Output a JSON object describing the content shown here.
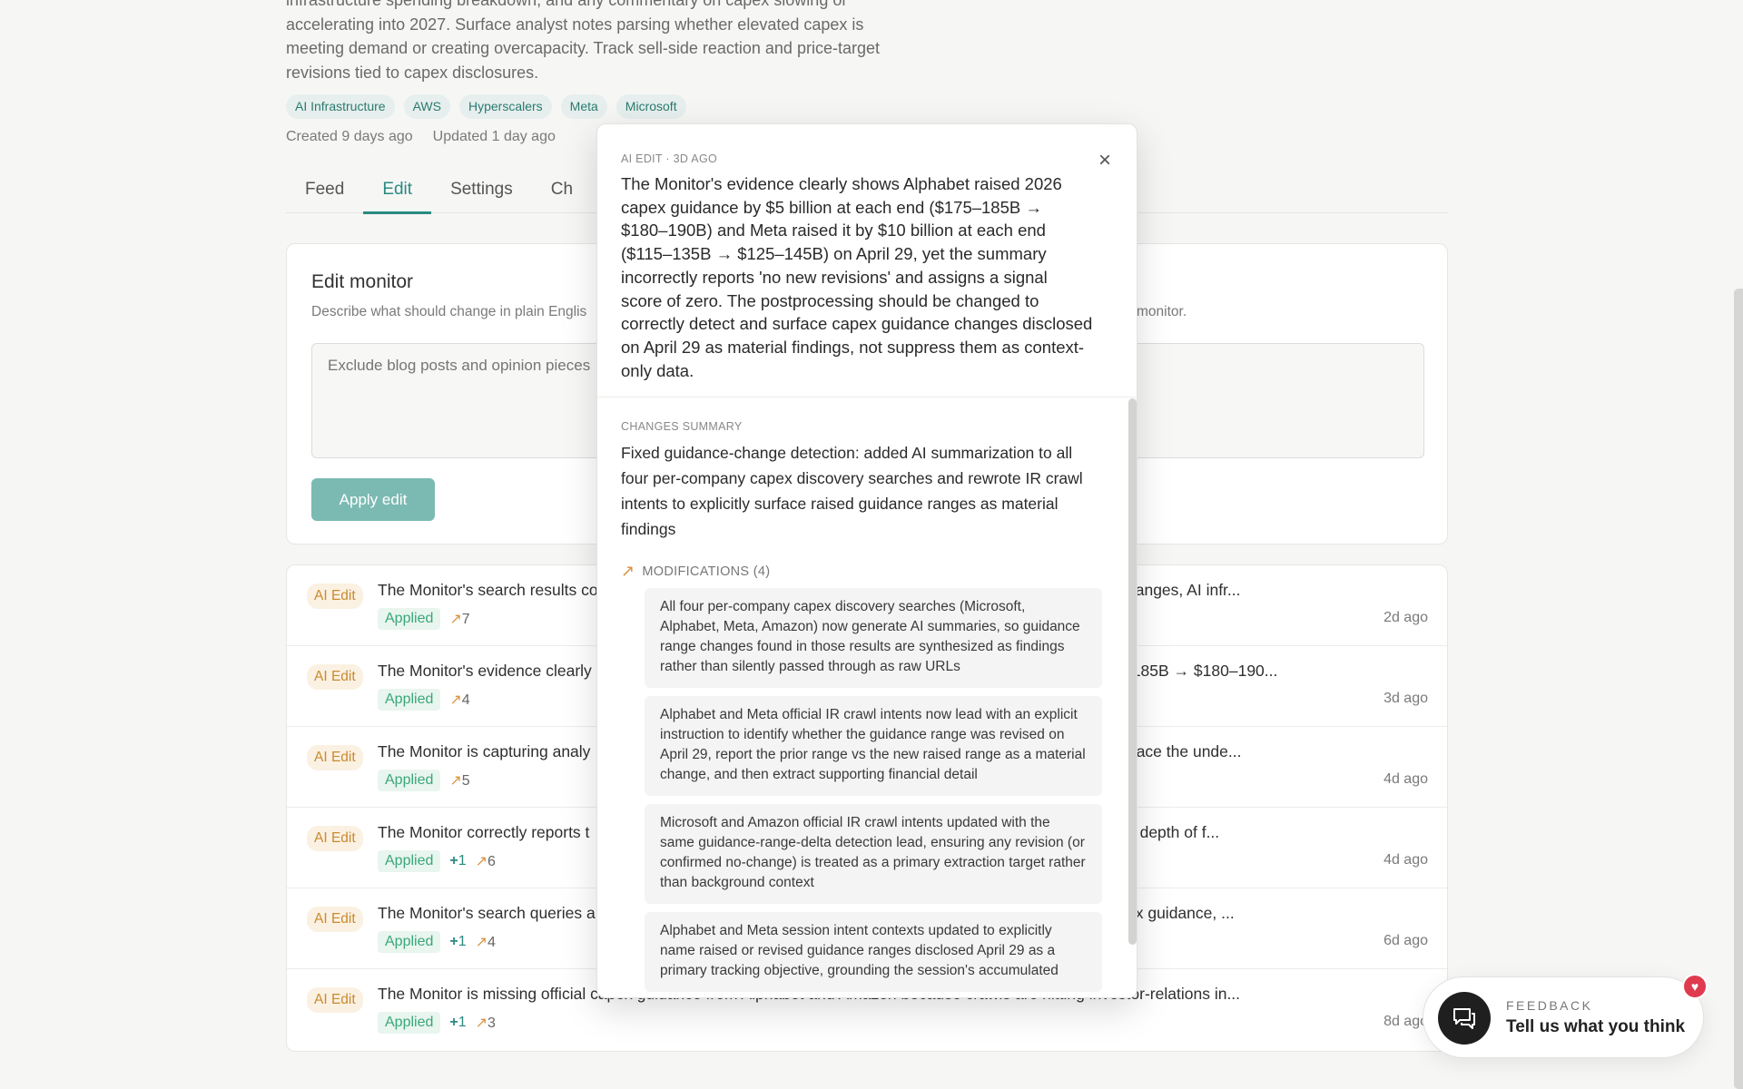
{
  "monitor": {
    "description": "infrastructure spending breakdown, and any commentary on capex slowing or accelerating into 2027. Surface analyst notes parsing whether elevated capex is meeting demand or creating overcapacity. Track sell-side reaction and price-target revisions tied to capex disclosures.",
    "tags": [
      "AI Infrastructure",
      "AWS",
      "Hyperscalers",
      "Meta",
      "Microsoft"
    ],
    "created": "Created 9 days ago",
    "updated": "Updated 1 day ago"
  },
  "tabs": [
    {
      "label": "Feed",
      "active": false
    },
    {
      "label": "Edit",
      "active": true
    },
    {
      "label": "Settings",
      "active": false
    },
    {
      "label": "Ch",
      "active": false
    }
  ],
  "edit": {
    "title": "Edit monitor",
    "subtitle": "Describe what should change in plain Englis",
    "subtitle_tail": "monitor.",
    "placeholder": "Exclude blog posts and opinion pieces",
    "apply_label": "Apply edit"
  },
  "history": [
    {
      "badge": "AI Edit",
      "title": "The Monitor's search results co",
      "tail": "hanges, AI infr...",
      "status": "Applied",
      "added": "",
      "modified": "7",
      "date": "2d ago"
    },
    {
      "badge": "AI Edit",
      "title": "The Monitor's evidence clearly",
      "tail": "-185B → $180–190...",
      "status": "Applied",
      "added": "",
      "modified": "4",
      "date": "3d ago"
    },
    {
      "badge": "AI Edit",
      "title": "The Monitor is capturing analy",
      "tail": "rface the unde...",
      "status": "Applied",
      "added": "",
      "modified": "5",
      "date": "4d ago"
    },
    {
      "badge": "AI Edit",
      "title": "The Monitor correctly reports t",
      "tail": "e depth of f...",
      "status": "Applied",
      "added": "1",
      "modified": "6",
      "date": "4d ago"
    },
    {
      "badge": "AI Edit",
      "title": "The Monitor's search queries a",
      "tail": "ex guidance, ...",
      "status": "Applied",
      "added": "1",
      "modified": "4",
      "date": "6d ago"
    },
    {
      "badge": "AI Edit",
      "title": "The Monitor is missing official capex guidance from Alphabet and Amazon because crawls are hitting investor-relations in...",
      "tail": "",
      "status": "Applied",
      "added": "1",
      "modified": "3",
      "date": "8d ago"
    }
  ],
  "popover": {
    "label": "AI EDIT · 3D AGO",
    "text": "The Monitor's evidence clearly shows Alphabet raised 2026 capex guidance by $5 billion at each end ($175–185B → $180–190B) and Meta raised it by $10 billion at each end ($115–135B → $125–145B) on April 29, yet the summary incorrectly reports 'no new revisions' and assigns a signal score of zero. The postprocessing should be changed to correctly detect and surface capex guidance changes disclosed on April 29 as material findings, not suppress them as context-only data.",
    "summary_label": "CHANGES SUMMARY",
    "summary": "Fixed guidance-change detection: added AI summarization to all four per-company capex discovery searches and rewrote IR crawl intents to explicitly surface raised guidance ranges as material findings",
    "modifications_label": "MODIFICATIONS (4)",
    "modifications": [
      "All four per-company capex discovery searches (Microsoft, Alphabet, Meta, Amazon) now generate AI summaries, so guidance range changes found in those results are synthesized as findings rather than silently passed through as raw URLs",
      "Alphabet and Meta official IR crawl intents now lead with an explicit instruction to identify whether the guidance range was revised on April 29, report the prior range vs the new raised range as a material change, and then extract supporting financial detail",
      "Microsoft and Amazon official IR crawl intents updated with the same guidance-range-delta detection lead, ensuring any revision (or confirmed no-change) is treated as a primary extraction target rather than background context",
      "Alphabet and Meta session intent contexts updated to explicitly name raised or revised guidance ranges disclosed April 29 as a primary tracking objective, grounding the session's accumulated"
    ]
  },
  "feedback": {
    "label": "FEEDBACK",
    "title": "Tell us what you think"
  }
}
